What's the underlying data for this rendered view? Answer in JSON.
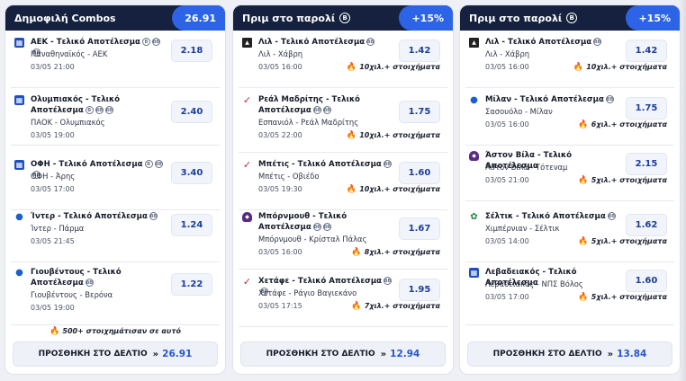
{
  "colors": {
    "header_bg": "#15213f",
    "badge_bg": "#2d64e6",
    "odds_text": "#1d3f9a",
    "fire": "#f26a16"
  },
  "columns": [
    {
      "title": "Δημοφιλή Combos",
      "title_icon": "",
      "badge": "26.91",
      "items": [
        {
          "logo": "blue",
          "title": "ΑΕΚ - Τελικό Αποτέλεσμα",
          "tags": [
            "B",
            "BB",
            "BB"
          ],
          "match": "Παναθηναϊκός - ΑΕΚ",
          "time": "03/05 21:00",
          "odds": "2.18",
          "promo": ""
        },
        {
          "logo": "blue",
          "title": "Ολυμπιακός - Τελικό Αποτέλεσμα",
          "tags": [
            "B",
            "BB",
            "BB"
          ],
          "match": "ΠΑΟΚ - Ολυμπιακός",
          "time": "03/05 19:00",
          "odds": "2.40",
          "promo": ""
        },
        {
          "logo": "blue",
          "title": "ΟΦΗ - Τελικό Αποτέλεσμα",
          "tags": [
            "B",
            "BB",
            "BB"
          ],
          "match": "ΟΦΗ - Άρης",
          "time": "03/05 17:00",
          "odds": "3.40",
          "promo": ""
        },
        {
          "logo": "drop",
          "title": "Ίντερ - Τελικό Αποτέλεσμα",
          "tags": [
            "BB"
          ],
          "match": "Ίντερ - Πάρμα",
          "time": "03/05 21:45",
          "odds": "1.24",
          "promo": ""
        },
        {
          "logo": "drop",
          "title": "Γιουβέντους - Τελικό Αποτέλεσμα",
          "tags": [
            "BB"
          ],
          "match": "Γιουβέντους - Βερόνα",
          "time": "03/05 19:00",
          "odds": "1.22",
          "promo": ""
        }
      ],
      "note": "500+ στοιχημάτισαν σε αυτό",
      "button_label": "ΠΡΟΣΘΗΚΗ ΣΤΟ ΔΕΛΤΙΟ",
      "button_total": "26.91"
    },
    {
      "title": "Πριμ στο παρολί",
      "title_icon": "B",
      "badge": "+15%",
      "items": [
        {
          "logo": "black",
          "title": "Λιλ - Τελικό Αποτέλεσμα",
          "tags": [
            "BB"
          ],
          "match": "Λιλ - Χάβρη",
          "time": "03/05 16:00",
          "odds": "1.42",
          "promo": "10χιλ.+ στοιχήματα"
        },
        {
          "logo": "red",
          "title": "Ρεάλ Μαδρίτης - Τελικό Αποτέλεσμα",
          "tags": [
            "BB",
            "BB"
          ],
          "match": "Εσπανιόλ - Ρεάλ Μαδρίτης",
          "time": "03/05 22:00",
          "odds": "1.75",
          "promo": "10χιλ.+ στοιχήματα"
        },
        {
          "logo": "red",
          "title": "Μπέτις - Τελικό Αποτέλεσμα",
          "tags": [
            "BB"
          ],
          "match": "Μπέτις - Οβιέδο",
          "time": "03/05 19:30",
          "odds": "1.60",
          "promo": "10χιλ.+ στοιχήματα"
        },
        {
          "logo": "purple",
          "title": "Μπόρνμουθ - Τελικό Αποτέλεσμα",
          "tags": [
            "BB",
            "BB"
          ],
          "match": "Μπόρνμουθ - Κρίσταλ Πάλας",
          "time": "03/05 16:00",
          "odds": "1.67",
          "promo": "8χιλ.+ στοιχήματα"
        },
        {
          "logo": "red",
          "title": "Χετάφε - Τελικό Αποτέλεσμα",
          "tags": [
            "BB",
            "BB"
          ],
          "match": "Χετάφε - Ράγιο Βαγιεκάνο",
          "time": "03/05 17:15",
          "odds": "1.95",
          "promo": "7χιλ.+ στοιχήματα"
        }
      ],
      "note": "",
      "button_label": "ΠΡΟΣΘΗΚΗ ΣΤΟ ΔΕΛΤΙΟ",
      "button_total": "12.94"
    },
    {
      "title": "Πριμ στο παρολί",
      "title_icon": "B",
      "badge": "+15%",
      "items": [
        {
          "logo": "black",
          "title": "Λιλ - Τελικό Αποτέλεσμα",
          "tags": [
            "BB"
          ],
          "match": "Λιλ - Χάβρη",
          "time": "03/05 16:00",
          "odds": "1.42",
          "promo": "10χιλ.+ στοιχήματα"
        },
        {
          "logo": "drop",
          "title": "Μίλαν - Τελικό Αποτέλεσμα",
          "tags": [
            "BB"
          ],
          "match": "Σασουόλο - Μίλαν",
          "time": "03/05 16:00",
          "odds": "1.75",
          "promo": "6χιλ.+ στοιχήματα"
        },
        {
          "logo": "purple",
          "title": "Άστον Βίλα - Τελικό Αποτέλεσμα",
          "tags": [],
          "match": "Άστον Βίλα - Τότεναμ",
          "time": "03/05 21:00",
          "odds": "2.15",
          "promo": "5χιλ.+ στοιχήματα"
        },
        {
          "logo": "green",
          "title": "Σέλτικ - Τελικό Αποτέλεσμα",
          "tags": [
            "BB"
          ],
          "match": "Χιμπέρνιαν - Σέλτικ",
          "time": "03/05 14:00",
          "odds": "1.62",
          "promo": "5χιλ.+ στοιχήματα"
        },
        {
          "logo": "blue",
          "title": "Λεβαδειακός - Τελικό Αποτέλεσμα",
          "tags": [],
          "match": "Λεβαδειακός - ΝΠΣ Βόλος",
          "time": "03/05 17:00",
          "odds": "1.60",
          "promo": "5χιλ.+ στοιχήματα"
        }
      ],
      "note": "",
      "button_label": "ΠΡΟΣΘΗΚΗ ΣΤΟ ΔΕΛΤΙΟ",
      "button_total": "13.84"
    }
  ]
}
